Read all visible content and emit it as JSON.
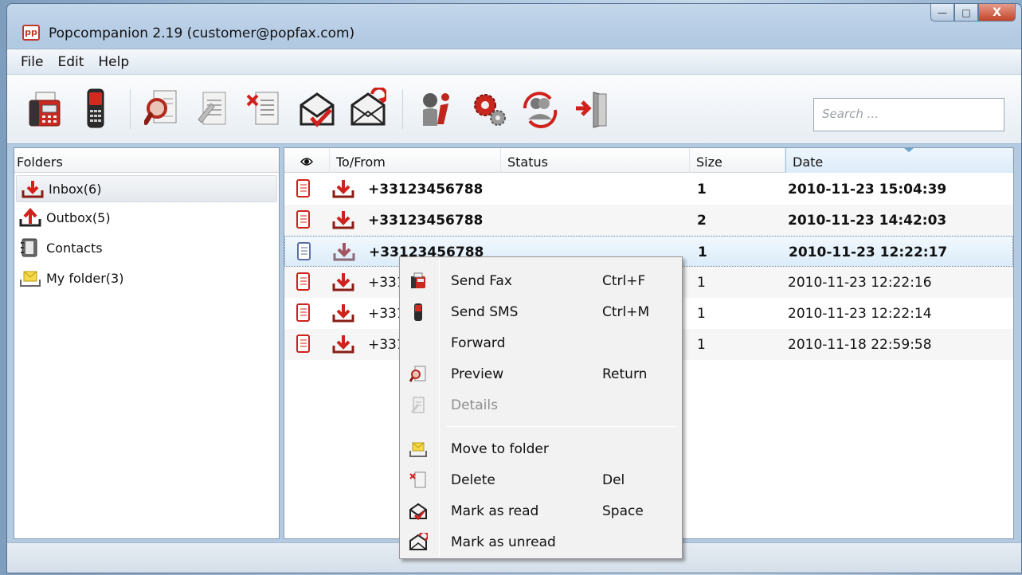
{
  "window": {
    "title": "Popcompanion 2.19 (customer@popfax.com)",
    "logo_text": "pp",
    "minimize_glyph": "—",
    "maximize_glyph": "□",
    "close_glyph": "X"
  },
  "menubar": {
    "items": [
      {
        "label": "File"
      },
      {
        "label": "Edit"
      },
      {
        "label": "Help"
      }
    ]
  },
  "toolbar": {
    "buttons": [
      {
        "icon": "fax-machine-icon"
      },
      {
        "icon": "mobile-phone-icon"
      },
      {
        "icon": "preview-magnifier-icon"
      },
      {
        "icon": "details-document-icon"
      },
      {
        "icon": "delete-document-icon"
      },
      {
        "icon": "mark-read-envelope-icon"
      },
      {
        "icon": "mark-unread-envelope-icon"
      },
      {
        "icon": "info-icon"
      },
      {
        "icon": "settings-gears-icon"
      },
      {
        "icon": "sync-users-icon"
      },
      {
        "icon": "exit-door-icon"
      }
    ],
    "search_placeholder": "Search ..."
  },
  "folders": {
    "header": "Folders",
    "items": [
      {
        "label": "Inbox(6)",
        "icon": "inbox-arrow-icon",
        "selected": true
      },
      {
        "label": "Outbox(5)",
        "icon": "outbox-arrow-icon",
        "selected": false
      },
      {
        "label": "Contacts",
        "icon": "contacts-book-icon",
        "selected": false
      },
      {
        "label": "My folder(3)",
        "icon": "folder-envelope-icon",
        "selected": false
      }
    ]
  },
  "messages": {
    "columns": {
      "read": "eye-icon",
      "to_from": "To/From",
      "status": "Status",
      "size": "Size",
      "date": "Date"
    },
    "rows": [
      {
        "number": "+33123456788",
        "status": "",
        "size": "1",
        "date": "2010-11-23 15:04:39",
        "unread": true
      },
      {
        "number": "+33123456788",
        "status": "",
        "size": "2",
        "date": "2010-11-23 14:42:03",
        "unread": true
      },
      {
        "number": "+33123456788",
        "status": "",
        "size": "1",
        "date": "2010-11-23 12:22:17",
        "unread": true,
        "selected": true
      },
      {
        "number": "+331",
        "status": "",
        "size": "1",
        "date": "2010-11-23 12:22:16",
        "unread": false
      },
      {
        "number": "+331",
        "status": "",
        "size": "1",
        "date": "2010-11-23 12:22:14",
        "unread": false
      },
      {
        "number": "+331",
        "status": "",
        "size": "1",
        "date": "2010-11-18 22:59:58",
        "unread": false
      }
    ]
  },
  "context_menu": {
    "items": [
      {
        "label": "Send Fax",
        "shortcut": "Ctrl+F",
        "icon": "fax-machine-icon",
        "enabled": true
      },
      {
        "label": "Send SMS",
        "shortcut": "Ctrl+M",
        "icon": "mobile-phone-icon",
        "enabled": true
      },
      {
        "label": "Forward",
        "shortcut": "",
        "icon": "",
        "enabled": true
      },
      {
        "label": "Preview",
        "shortcut": "Return",
        "icon": "preview-magnifier-icon",
        "enabled": true
      },
      {
        "label": "Details",
        "shortcut": "",
        "icon": "details-document-icon",
        "enabled": false
      },
      {
        "label": "Move to folder",
        "shortcut": "",
        "icon": "folder-envelope-icon",
        "enabled": true
      },
      {
        "label": "Delete",
        "shortcut": "Del",
        "icon": "delete-document-icon",
        "enabled": true
      },
      {
        "label": "Mark as read",
        "shortcut": "Space",
        "icon": "mark-read-envelope-icon",
        "enabled": true
      },
      {
        "label": "Mark as unread",
        "shortcut": "",
        "icon": "mark-unread-envelope-icon",
        "enabled": true
      }
    ]
  },
  "colors": {
    "accent_red": "#d0211c",
    "selection_blue": "#dbecf9",
    "titlebar": "#b9cfe6"
  }
}
